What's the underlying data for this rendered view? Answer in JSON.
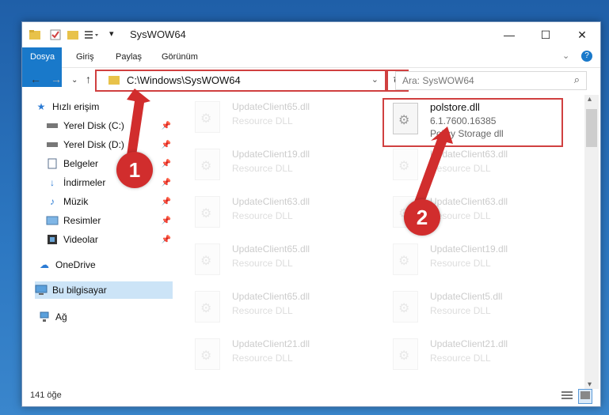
{
  "title": "SysWOW64",
  "ribbon": {
    "tabs": [
      "Dosya",
      "Giriş",
      "Paylaş",
      "Görünüm"
    ]
  },
  "window_controls": {
    "minimize": "—",
    "maximize": "☐",
    "close": "✕"
  },
  "address": {
    "path": "C:\\Windows\\SysWOW64"
  },
  "search": {
    "placeholder": "Ara: SysWOW64"
  },
  "sidebar": {
    "items": [
      {
        "label": "Hızlı erişim",
        "icon": "star-icon"
      },
      {
        "label": "Yerel Disk (C:)",
        "icon": "drive-icon",
        "pinned": true
      },
      {
        "label": "Yerel Disk (D:)",
        "icon": "drive-icon",
        "pinned": true
      },
      {
        "label": "Belgeler",
        "icon": "documents-icon",
        "pinned": true
      },
      {
        "label": "İndirmeler",
        "icon": "download-icon",
        "pinned": true
      },
      {
        "label": "Müzik",
        "icon": "music-icon",
        "pinned": true
      },
      {
        "label": "Resimler",
        "icon": "pictures-icon",
        "pinned": true
      },
      {
        "label": "Videolar",
        "icon": "video-icon",
        "pinned": true
      },
      {
        "label": "OneDrive",
        "icon": "cloud-icon"
      },
      {
        "label": "Bu bilgisayar",
        "icon": "computer-icon",
        "selected": true
      },
      {
        "label": "Ağ",
        "icon": "network-icon"
      }
    ]
  },
  "files": {
    "left": [
      {
        "name": "UpdateClient65.dll",
        "type": "Resource DLL"
      },
      {
        "name": "UpdateClient19.dll",
        "type": "Resource DLL"
      },
      {
        "name": "UpdateClient63.dll",
        "type": "Resource DLL"
      },
      {
        "name": "UpdateClient65.dll",
        "type": "Resource DLL"
      },
      {
        "name": "UpdateClient65.dll",
        "type": "Resource DLL"
      },
      {
        "name": "UpdateClient21.dll",
        "type": "Resource DLL"
      }
    ],
    "right": [
      {
        "name": "polstore.dll",
        "version": "6.1.7600.16385",
        "type": "Policy Storage dll",
        "highlighted": true
      },
      {
        "name": "UpdateClient63.dll",
        "type": "Resource DLL"
      },
      {
        "name": "UpdateClient63.dll",
        "type": "Resource DLL"
      },
      {
        "name": "UpdateClient19.dll",
        "type": "Resource DLL"
      },
      {
        "name": "UpdateClient5.dll",
        "type": "Resource DLL"
      },
      {
        "name": "UpdateClient21.dll",
        "type": "Resource DLL"
      }
    ]
  },
  "status": {
    "count": "141 öğe"
  },
  "annotations": [
    "1",
    "2"
  ],
  "colors": {
    "accent": "#1979ca",
    "highlight": "#d04040",
    "selected": "#cce4f7"
  }
}
